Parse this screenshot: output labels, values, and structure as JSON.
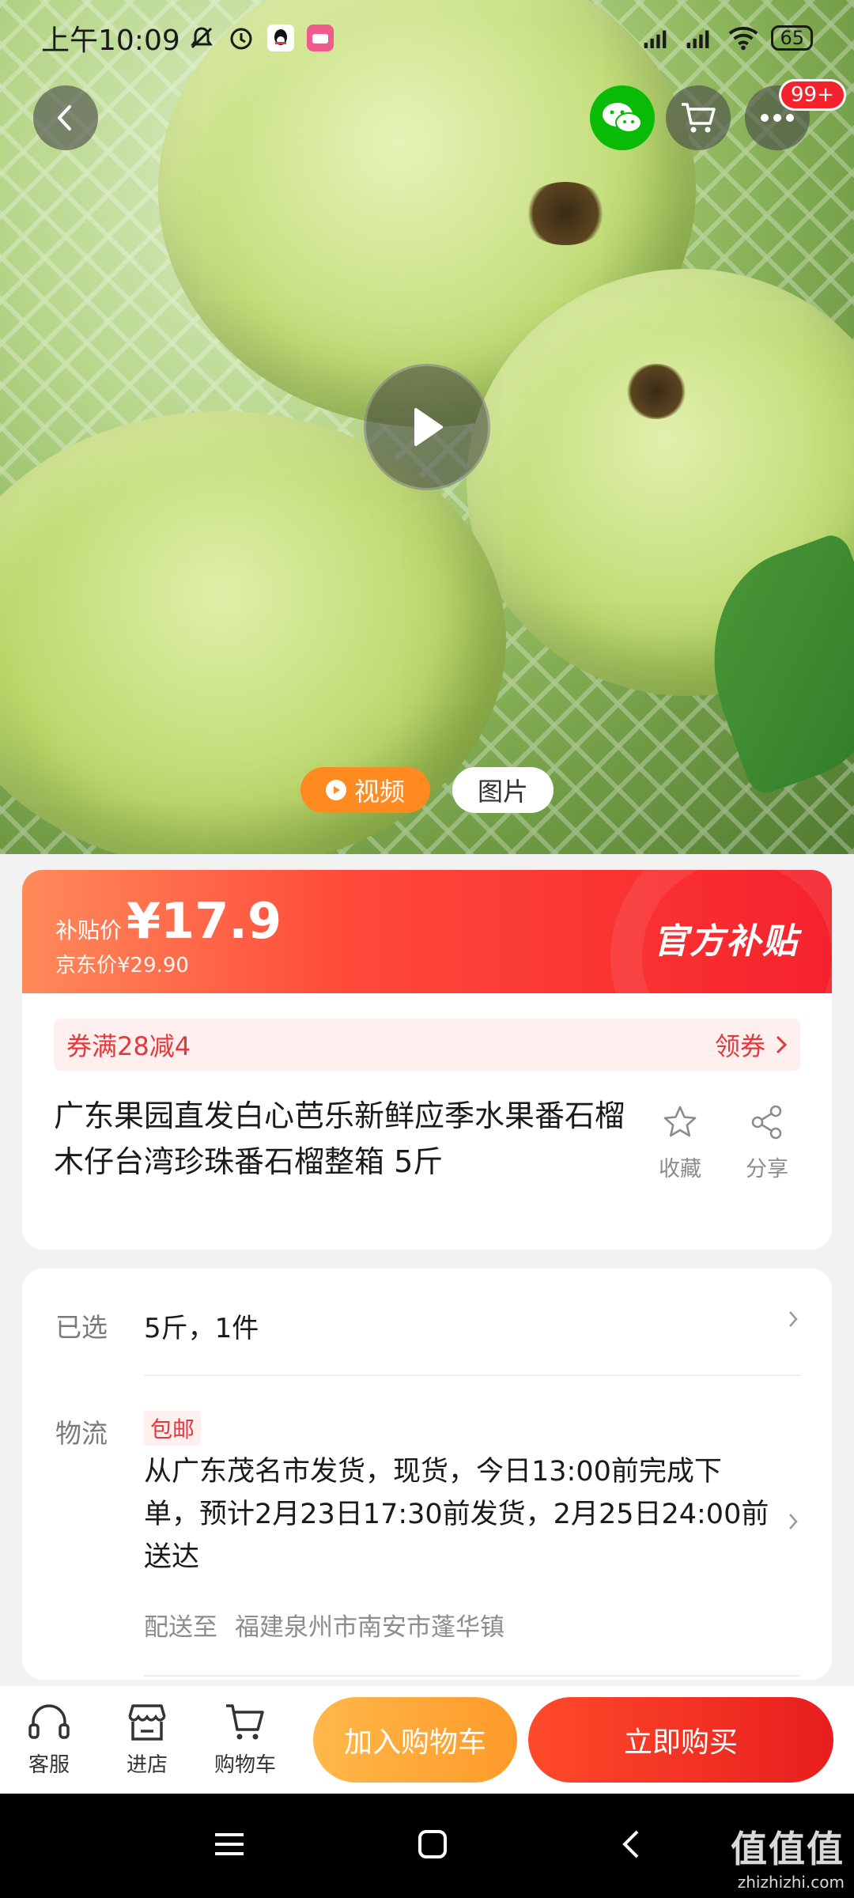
{
  "status_bar": {
    "time": "上午10:09",
    "battery": "65"
  },
  "top_actions": {
    "more_badge": "99+"
  },
  "media_tabs": {
    "video": "视频",
    "photo": "图片"
  },
  "price_banner": {
    "price_label": "补贴价",
    "price_value": "¥17.9",
    "jd_price": "京东价¥29.90",
    "official_tag": "官方补贴",
    "colors": {
      "start": "#ff8a5a",
      "end": "#f5222d"
    }
  },
  "coupon": {
    "text": "券满28减4",
    "action": "领券"
  },
  "product": {
    "title": "广东果园直发白心芭乐新鲜应季水果番石榴木仔台湾珍珠番石榴整箱 5斤",
    "favorite_label": "收藏",
    "share_label": "分享"
  },
  "selection": {
    "label": "已选",
    "value": "5斤，1件"
  },
  "logistics": {
    "label": "物流",
    "free_shipping": "包邮",
    "text": "从广东茂名市发货，现货，今日13:00前完成下单，预计2月23日17:30前发货，2月25日24:00前送达",
    "deliver_label": "配送至",
    "deliver_address": "福建泉州市南安市蓬华镇"
  },
  "bottom_bar": {
    "service": "客服",
    "store": "进店",
    "cart": "购物车",
    "add_to_cart": "加入购物车",
    "buy_now": "立即购买"
  },
  "watermark": {
    "big": "值值值",
    "small": "zhizhizhi.com"
  }
}
